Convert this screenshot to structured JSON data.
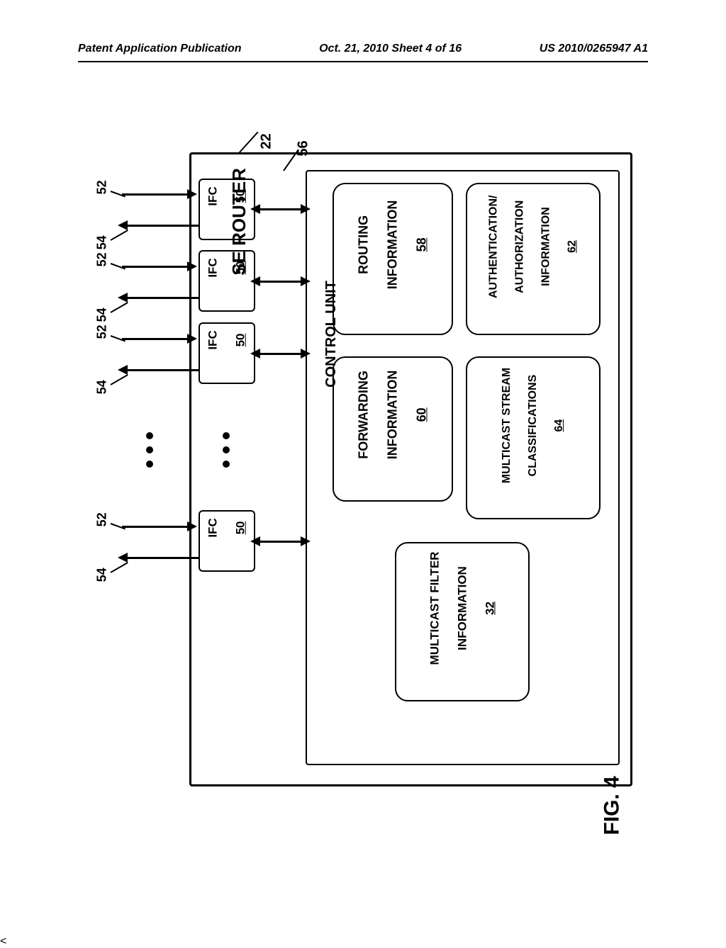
{
  "header": {
    "left": "Patent Application Publication",
    "center": "Oct. 21, 2010  Sheet 4 of 16",
    "right": "US 2010/0265947 A1"
  },
  "figure": "FIG. 4",
  "router": {
    "title": "SE ROUTER",
    "ref": "22"
  },
  "control": {
    "title": "CONTROL UNIT",
    "ref": "56"
  },
  "boxes": {
    "routing": {
      "line1": "ROUTING",
      "line2": "INFORMATION",
      "ref": "58"
    },
    "auth": {
      "line1": "AUTHENTICATION/",
      "line2": "AUTHORIZATION",
      "line3": "INFORMATION",
      "ref": "62"
    },
    "forward": {
      "line1": "FORWARDING",
      "line2": "INFORMATION",
      "ref": "60"
    },
    "mstream": {
      "line1": "MULTICAST STREAM",
      "line2": "CLASSIFICATIONS",
      "ref": "64"
    },
    "mfilter": {
      "line1": "MULTICAST FILTER",
      "line2": "INFORMATION",
      "ref": "32"
    }
  },
  "ifc": {
    "label": "IFC",
    "ref": "50"
  },
  "ext": {
    "in": "52",
    "out": "54"
  }
}
